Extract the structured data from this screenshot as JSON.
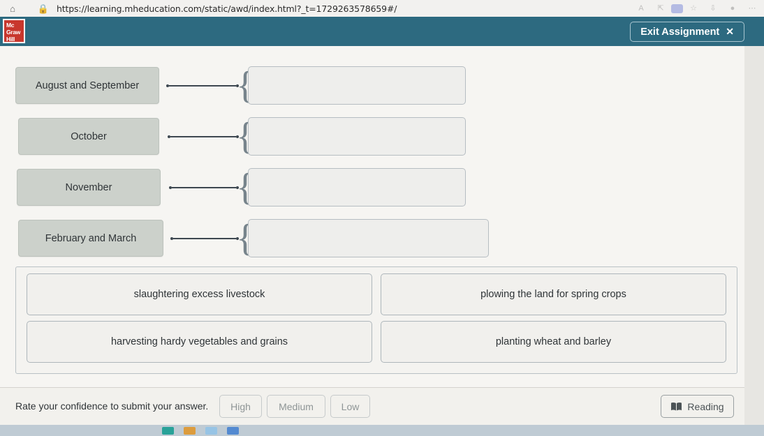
{
  "browser": {
    "url": "https://learning.mheducation.com/static/awd/index.html?_t=1729263578659#/",
    "home_icon": "home-icon",
    "lock_icon": "lock-icon"
  },
  "header": {
    "logo_line1": "Mc",
    "logo_line2": "Graw",
    "logo_line3": "Hill",
    "exit_label": "Exit Assignment",
    "exit_close_glyph": "✕",
    "background_color": "#2d6a80"
  },
  "matching": {
    "brace_glyph": "{",
    "rows": [
      {
        "term": "August and September",
        "answer": ""
      },
      {
        "term": "October",
        "answer": ""
      },
      {
        "term": "November",
        "answer": ""
      },
      {
        "term": "February and March",
        "answer": ""
      }
    ]
  },
  "answer_bank": {
    "options": [
      "slaughtering excess livestock",
      "plowing the land for spring crops",
      "harvesting hardy vegetables and grains",
      "planting wheat and barley"
    ]
  },
  "footer": {
    "confidence_prompt": "Rate your confidence to submit your answer.",
    "confidence_options": [
      "High",
      "Medium",
      "Low"
    ],
    "reading_label": "Reading",
    "reading_icon": "book-icon"
  }
}
